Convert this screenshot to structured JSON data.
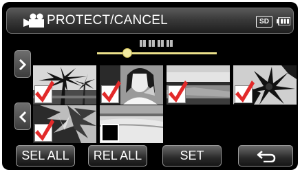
{
  "header": {
    "title": "PROTECT/CANCEL",
    "media_badge": "SD",
    "icons": [
      "video-camera-icon",
      "battery-icon"
    ]
  },
  "pagination": {
    "position_fraction": 0.24,
    "accent_color": "#ebe08a"
  },
  "navigation": {
    "next_icon": "chevron-right-icon",
    "prev_icon": "chevron-left-icon"
  },
  "thumbnails": [
    {
      "scene": "palm trees silhouette",
      "selected": true
    },
    {
      "scene": "woman portrait",
      "selected": true
    },
    {
      "scene": "lakeside horizon",
      "selected": true
    },
    {
      "scene": "flower silhouette",
      "selected": true
    },
    {
      "scene": "tropical plants",
      "selected": true
    },
    {
      "scene": "sandy beach",
      "selected": false
    }
  ],
  "buttons": {
    "select_all": "SEL ALL",
    "release_all": "REL ALL",
    "set": "SET",
    "back_icon": "return-arrow-icon"
  }
}
